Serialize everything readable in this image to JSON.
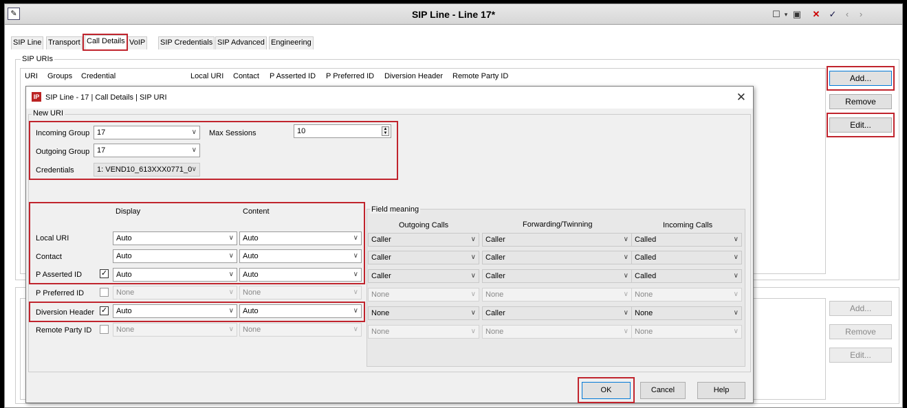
{
  "window": {
    "title": "SIP Line - Line 17*",
    "toolbar": [
      "new-icon",
      "dropdown-icon",
      "save-icon",
      "close-icon",
      "check-icon",
      "prev-icon",
      "next-icon"
    ]
  },
  "tabs": [
    "SIP Line",
    "Transport",
    "Call Details",
    "VoIP",
    "SIP Credentials",
    "SIP Advanced",
    "Engineering"
  ],
  "sip_uris": {
    "legend": "SIP URIs",
    "columns": [
      "URI",
      "Groups",
      "Credential",
      "Local URI",
      "Contact",
      "P Asserted ID",
      "P Preferred ID",
      "Diversion Header",
      "Remote Party ID"
    ],
    "buttons": [
      "Add...",
      "Remove",
      "Edit..."
    ]
  },
  "lower_buttons": [
    "Add...",
    "Remove",
    "Edit..."
  ],
  "dialog": {
    "title": "SIP Line - 17 | Call Details | SIP URI",
    "new_uri_legend": "New URI",
    "incoming_group_label": "Incoming Group",
    "incoming_group_value": "17",
    "outgoing_group_label": "Outgoing Group",
    "outgoing_group_value": "17",
    "credentials_label": "Credentials",
    "credentials_value": "1: VEND10_613XXX0771_0",
    "max_sessions_label": "Max Sessions",
    "max_sessions_value": "10",
    "display_header": "Display",
    "content_header": "Content",
    "field_meaning_legend": "Field meaning",
    "outgoing_calls_header": "Outgoing Calls",
    "forwarding_header": "Forwarding/Twinning",
    "incoming_calls_header": "Incoming Calls",
    "rows": [
      {
        "label": "Local URI",
        "checkbox": "",
        "display": "Auto",
        "content": "Auto",
        "outgoing": "Caller",
        "forwarding": "Caller",
        "incoming": "Called"
      },
      {
        "label": "Contact",
        "checkbox": "",
        "display": "Auto",
        "content": "Auto",
        "outgoing": "Caller",
        "forwarding": "Caller",
        "incoming": "Called"
      },
      {
        "label": "P Asserted ID",
        "checkbox": "✓",
        "display": "Auto",
        "content": "Auto",
        "outgoing": "Caller",
        "forwarding": "Caller",
        "incoming": "Called"
      },
      {
        "label": "P Preferred ID",
        "checkbox": "",
        "display": "None",
        "content": "None",
        "outgoing": "None",
        "forwarding": "None",
        "incoming": "None"
      },
      {
        "label": "Diversion Header",
        "checkbox": "✓",
        "display": "Auto",
        "content": "Auto",
        "outgoing": "None",
        "forwarding": "Caller",
        "incoming": "None"
      },
      {
        "label": "Remote Party ID",
        "checkbox": "",
        "display": "None",
        "content": "None",
        "outgoing": "None",
        "forwarding": "None",
        "incoming": "None"
      }
    ],
    "ok": "OK",
    "cancel": "Cancel",
    "help": "Help"
  },
  "colors": {
    "highlight": "#c0232c",
    "dialog_bg": "#f0f0f0"
  }
}
